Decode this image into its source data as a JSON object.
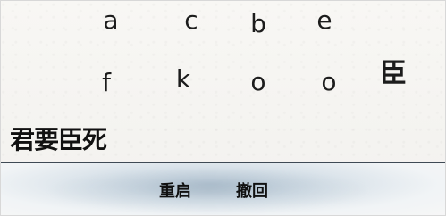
{
  "board": {
    "row1": [
      "a",
      "c",
      "b",
      "e"
    ],
    "row2": [
      "f",
      "k",
      "o",
      "o",
      "臣"
    ]
  },
  "phrase": "君要臣死",
  "actions": {
    "reset": "重启",
    "undo": "撤回"
  }
}
